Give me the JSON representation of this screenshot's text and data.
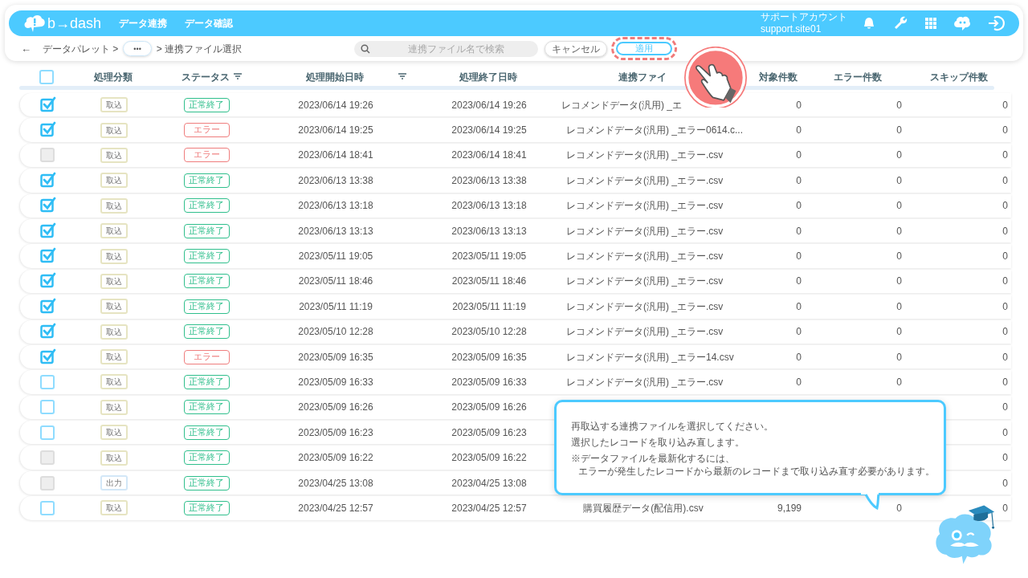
{
  "header": {
    "logo": "b→dash",
    "nav": [
      "データ連携",
      "データ確認"
    ],
    "account_name": "サポートアカウント",
    "account_id": "support.site01"
  },
  "toolbar": {
    "back": "←",
    "breadcrumb_root": "データパレット >",
    "breadcrumb_more": "•••",
    "breadcrumb_current": "> 連携ファイル選択",
    "search": {
      "placeholder": "連携ファイル名で検索"
    },
    "cancel": "キャンセル",
    "apply": "適用"
  },
  "table": {
    "select_all": {
      "checked": false
    },
    "columns": [
      {
        "label": "処理分類",
        "filter": false
      },
      {
        "label": "ステータス",
        "filter": true
      },
      {
        "label": "処理開始日時",
        "filter": true
      },
      {
        "label": "処理終了日時",
        "filter": false
      },
      {
        "label": "連携ファイ",
        "filter": false
      },
      {
        "label": "対象件数",
        "filter": false
      },
      {
        "label": "エラー件数",
        "filter": false
      },
      {
        "label": "スキップ件数",
        "filter": false
      }
    ],
    "rows": [
      {
        "checked": true,
        "disabled": false,
        "category": {
          "label": "取込",
          "kind": "import"
        },
        "status": {
          "label": "正常終了",
          "kind": "ok"
        },
        "start": "2023/06/14 19:26",
        "end": "2023/06/14 19:26",
        "file": "レコメンドデータ(汎用) _エ",
        "target": "0",
        "errors": "0",
        "skip": "0"
      },
      {
        "checked": true,
        "disabled": false,
        "category": {
          "label": "取込",
          "kind": "import"
        },
        "status": {
          "label": "エラー",
          "kind": "error"
        },
        "start": "2023/06/14 19:25",
        "end": "2023/06/14 19:25",
        "file": "レコメンドデータ(汎用) _エラー0614.c...",
        "target": "0",
        "errors": "0",
        "skip": "0"
      },
      {
        "checked": false,
        "disabled": true,
        "category": {
          "label": "取込",
          "kind": "import"
        },
        "status": {
          "label": "エラー",
          "kind": "error"
        },
        "start": "2023/06/14 18:41",
        "end": "2023/06/14 18:41",
        "file": "レコメンドデータ(汎用) _エラー.csv",
        "target": "0",
        "errors": "0",
        "skip": "0"
      },
      {
        "checked": true,
        "disabled": false,
        "category": {
          "label": "取込",
          "kind": "import"
        },
        "status": {
          "label": "正常終了",
          "kind": "ok"
        },
        "start": "2023/06/13 13:38",
        "end": "2023/06/13 13:38",
        "file": "レコメンドデータ(汎用) _エラー.csv",
        "target": "0",
        "errors": "0",
        "skip": "0"
      },
      {
        "checked": true,
        "disabled": false,
        "category": {
          "label": "取込",
          "kind": "import"
        },
        "status": {
          "label": "正常終了",
          "kind": "ok"
        },
        "start": "2023/06/13 13:18",
        "end": "2023/06/13 13:18",
        "file": "レコメンドデータ(汎用) _エラー.csv",
        "target": "0",
        "errors": "0",
        "skip": "0"
      },
      {
        "checked": true,
        "disabled": false,
        "category": {
          "label": "取込",
          "kind": "import"
        },
        "status": {
          "label": "正常終了",
          "kind": "ok"
        },
        "start": "2023/06/13 13:13",
        "end": "2023/06/13 13:13",
        "file": "レコメンドデータ(汎用) _エラー.csv",
        "target": "0",
        "errors": "0",
        "skip": "0"
      },
      {
        "checked": true,
        "disabled": false,
        "category": {
          "label": "取込",
          "kind": "import"
        },
        "status": {
          "label": "正常終了",
          "kind": "ok"
        },
        "start": "2023/05/11 19:05",
        "end": "2023/05/11 19:05",
        "file": "レコメンドデータ(汎用) _エラー.csv",
        "target": "0",
        "errors": "0",
        "skip": "0"
      },
      {
        "checked": true,
        "disabled": false,
        "category": {
          "label": "取込",
          "kind": "import"
        },
        "status": {
          "label": "正常終了",
          "kind": "ok"
        },
        "start": "2023/05/11 18:46",
        "end": "2023/05/11 18:46",
        "file": "レコメンドデータ(汎用) _エラー.csv",
        "target": "0",
        "errors": "0",
        "skip": "0"
      },
      {
        "checked": true,
        "disabled": false,
        "category": {
          "label": "取込",
          "kind": "import"
        },
        "status": {
          "label": "正常終了",
          "kind": "ok"
        },
        "start": "2023/05/11 11:19",
        "end": "2023/05/11 11:19",
        "file": "レコメンドデータ(汎用) _エラー.csv",
        "target": "0",
        "errors": "0",
        "skip": "0"
      },
      {
        "checked": true,
        "disabled": false,
        "category": {
          "label": "取込",
          "kind": "import"
        },
        "status": {
          "label": "正常終了",
          "kind": "ok"
        },
        "start": "2023/05/10 12:28",
        "end": "2023/05/10 12:28",
        "file": "レコメンドデータ(汎用) _エラー.csv",
        "target": "0",
        "errors": "0",
        "skip": "0"
      },
      {
        "checked": true,
        "disabled": false,
        "category": {
          "label": "取込",
          "kind": "import"
        },
        "status": {
          "label": "エラー",
          "kind": "error"
        },
        "start": "2023/05/09 16:35",
        "end": "2023/05/09 16:35",
        "file": "レコメンドデータ(汎用) _エラー14.csv",
        "target": "0",
        "errors": "0",
        "skip": "0"
      },
      {
        "checked": false,
        "disabled": false,
        "category": {
          "label": "取込",
          "kind": "import"
        },
        "status": {
          "label": "正常終了",
          "kind": "ok"
        },
        "start": "2023/05/09 16:33",
        "end": "2023/05/09 16:33",
        "file": "レコメンドデータ(汎用) _エラー.csv",
        "target": "0",
        "errors": "0",
        "skip": "0"
      },
      {
        "checked": false,
        "disabled": false,
        "category": {
          "label": "取込",
          "kind": "import"
        },
        "status": {
          "label": "正常終了",
          "kind": "ok"
        },
        "start": "2023/05/09 16:26",
        "end": "2023/05/09 16:26",
        "skip": "0"
      },
      {
        "checked": false,
        "disabled": false,
        "category": {
          "label": "取込",
          "kind": "import"
        },
        "status": {
          "label": "正常終了",
          "kind": "ok"
        },
        "start": "2023/05/09 16:23",
        "end": "2023/05/09 16:23",
        "skip": "0"
      },
      {
        "checked": false,
        "disabled": true,
        "category": {
          "label": "取込",
          "kind": "import"
        },
        "status": {
          "label": "正常終了",
          "kind": "ok"
        },
        "start": "2023/05/09 16:22",
        "end": "2023/05/09 16:22",
        "skip": "0"
      },
      {
        "checked": false,
        "disabled": true,
        "category": {
          "label": "出力",
          "kind": "export"
        },
        "status": {
          "label": "正常終了",
          "kind": "ok"
        },
        "start": "2023/04/25 13:08",
        "end": "2023/04/25 13:08",
        "skip": "0"
      },
      {
        "checked": false,
        "disabled": false,
        "category": {
          "label": "取込",
          "kind": "import"
        },
        "status": {
          "label": "正常終了",
          "kind": "ok"
        },
        "start": "2023/04/25 12:57",
        "end": "2023/04/25 12:57",
        "file": "購買履歴データ(配信用).csv",
        "target": "9,199",
        "errors": "0",
        "skip": "0"
      }
    ]
  },
  "tooltip": {
    "lines": [
      "再取込する連携ファイルを選択してください。",
      "選択したレコードを取り込み直します。"
    ],
    "note": [
      "※データファイルを最新化するには、",
      "エラーが発生したレコードから最新のレコードまで取り込み直す必要があります。"
    ]
  }
}
